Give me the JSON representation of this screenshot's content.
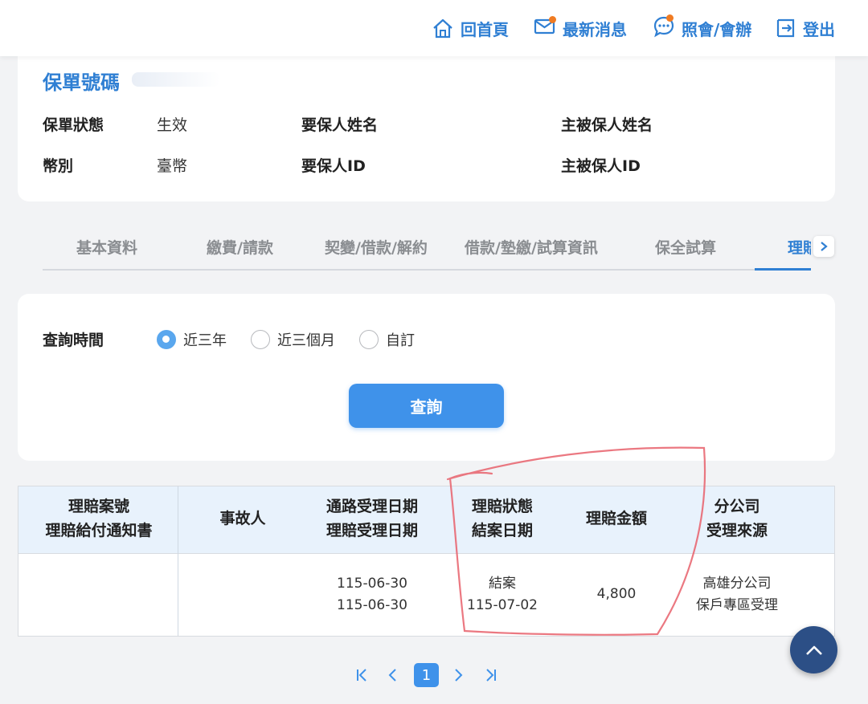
{
  "nav": {
    "home": "回首頁",
    "news": "最新消息",
    "inquiry": "照會/會辦",
    "logout": "登出"
  },
  "policy": {
    "title": "保單號碼",
    "status_label": "保單狀態",
    "status_value": "生效",
    "holder_name_label": "要保人姓名",
    "insured_name_label": "主被保人姓名",
    "currency_label": "幣別",
    "currency_value": "臺幣",
    "holder_id_label": "要保人ID",
    "insured_id_label": "主被保人ID"
  },
  "tabs": [
    "基本資料",
    "繳費/請款",
    "契變/借款/解約",
    "借款/墊繳/試算資訊",
    "保全試算",
    "理賠"
  ],
  "query": {
    "label": "查詢時間",
    "options": [
      "近三年",
      "近三個月",
      "自訂"
    ],
    "selected": "近三年",
    "button": "查詢"
  },
  "table": {
    "headers": [
      [
        "理賠案號",
        "理賠給付通知書"
      ],
      [
        "事故人"
      ],
      [
        "通路受理日期",
        "理賠受理日期"
      ],
      [
        "理賠狀態",
        "結案日期"
      ],
      [
        "理賠金額"
      ],
      [
        "分公司",
        "受理來源"
      ]
    ],
    "rows": [
      {
        "claim_no": "",
        "accident_person": "",
        "channel_date": "115-06-30",
        "claim_accept_date": "115-06-30",
        "status": "結案",
        "close_date": "115-07-02",
        "amount": "4,800",
        "branch": "高雄分公司",
        "source": "保戶專區受理"
      }
    ]
  },
  "pagination": {
    "current_page": "1"
  },
  "colors": {
    "accent": "#2f7fd3",
    "button": "#3f92ea",
    "header_bg": "#e8f2fc",
    "notify_dot": "#f07b22",
    "annotation": "#e8606b",
    "fab": "#2c4f86"
  }
}
